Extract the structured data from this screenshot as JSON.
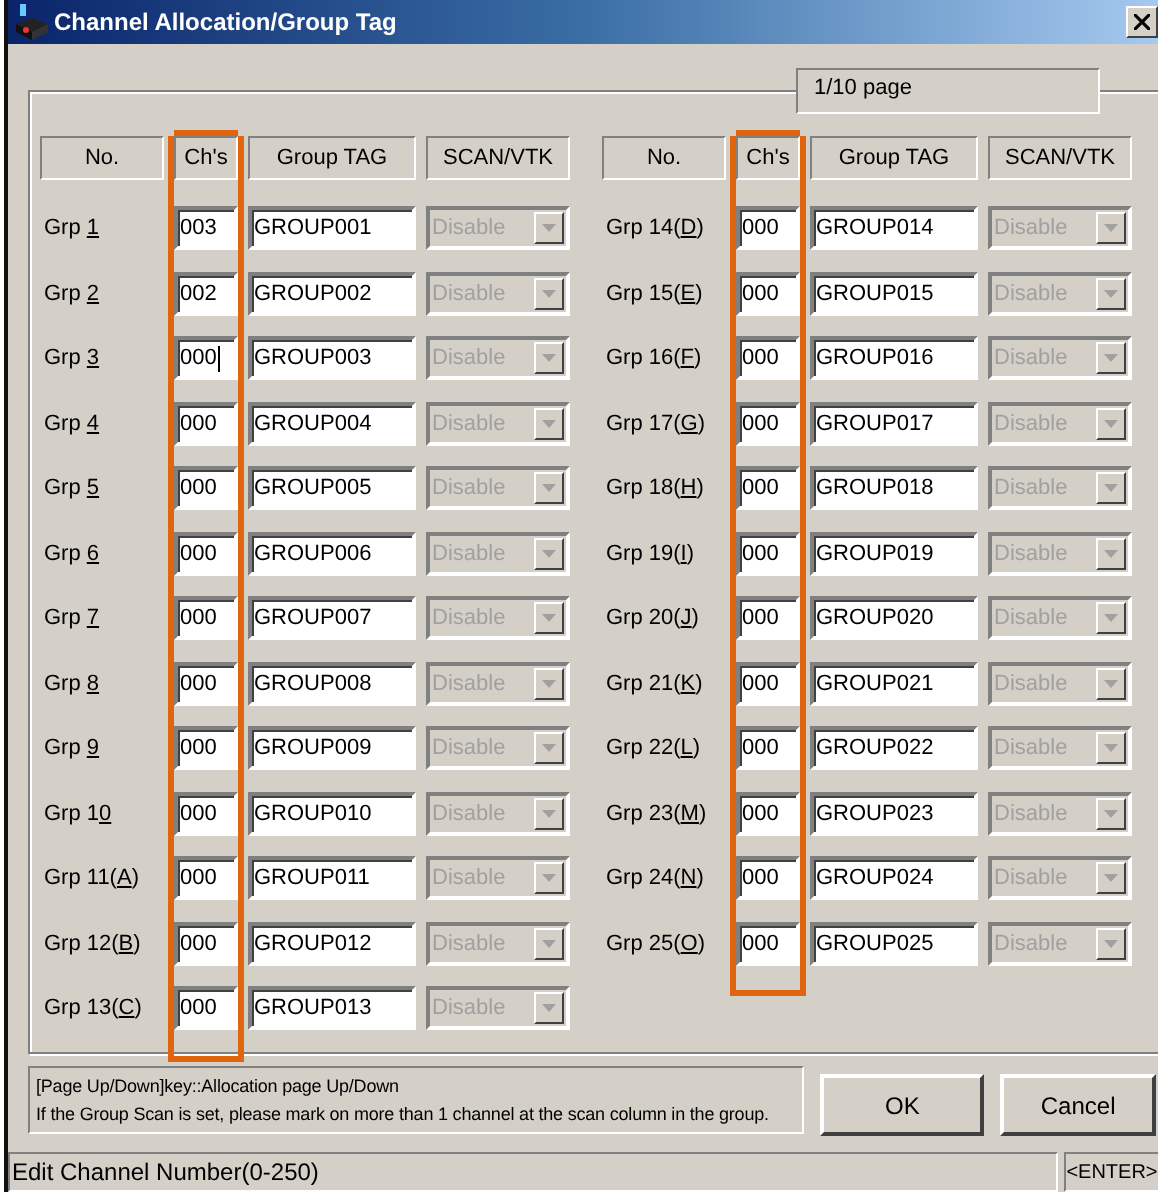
{
  "window": {
    "title": "Channel Allocation/Group Tag"
  },
  "page_indicator": "1/10 page",
  "left_headers": [
    "No.",
    "Ch's",
    "Group TAG",
    "SCAN/VTK"
  ],
  "right_headers": [
    "No.",
    "Ch's",
    "Group TAG",
    "SCAN/VTK"
  ],
  "left_groups": [
    {
      "label": "Grp ",
      "access_key": "1",
      "channels": "003",
      "focused": false,
      "tag": "GROUP001",
      "scan": "Disable",
      "scan_disabled": true
    },
    {
      "label": "Grp ",
      "access_key": "2",
      "channels": "002",
      "focused": false,
      "tag": "GROUP002",
      "scan": "Disable",
      "scan_disabled": true
    },
    {
      "label": "Grp ",
      "access_key": "3",
      "channels": "000",
      "focused": true,
      "tag": "GROUP003",
      "scan": "Disable",
      "scan_disabled": true
    },
    {
      "label": "Grp ",
      "access_key": "4",
      "channels": "000",
      "focused": false,
      "tag": "GROUP004",
      "scan": "Disable",
      "scan_disabled": true
    },
    {
      "label": "Grp ",
      "access_key": "5",
      "channels": "000",
      "focused": false,
      "tag": "GROUP005",
      "scan": "Disable",
      "scan_disabled": true
    },
    {
      "label": "Grp ",
      "access_key": "6",
      "channels": "000",
      "focused": false,
      "tag": "GROUP006",
      "scan": "Disable",
      "scan_disabled": true
    },
    {
      "label": "Grp ",
      "access_key": "7",
      "channels": "000",
      "focused": false,
      "tag": "GROUP007",
      "scan": "Disable",
      "scan_disabled": true
    },
    {
      "label": "Grp ",
      "access_key": "8",
      "channels": "000",
      "focused": false,
      "tag": "GROUP008",
      "scan": "Disable",
      "scan_disabled": true
    },
    {
      "label": "Grp ",
      "access_key": "9",
      "channels": "000",
      "focused": false,
      "tag": "GROUP009",
      "scan": "Disable",
      "scan_disabled": true
    },
    {
      "label": "Grp 1",
      "access_key": "0",
      "channels": "000",
      "focused": false,
      "tag": "GROUP010",
      "scan": "Disable",
      "scan_disabled": true
    },
    {
      "label": "Grp 11(",
      "access_key": "A",
      "label_end": ")",
      "channels": "000",
      "focused": false,
      "tag": "GROUP011",
      "scan": "Disable",
      "scan_disabled": true
    },
    {
      "label": "Grp 12(",
      "access_key": "B",
      "label_end": ")",
      "channels": "000",
      "focused": false,
      "tag": "GROUP012",
      "scan": "Disable",
      "scan_disabled": true
    },
    {
      "label": "Grp 13(",
      "access_key": "C",
      "label_end": ")",
      "channels": "000",
      "focused": false,
      "tag": "GROUP013",
      "scan": "Disable",
      "scan_disabled": true
    }
  ],
  "right_groups": [
    {
      "label": "Grp 14(",
      "access_key": "D",
      "label_end": ")",
      "channels": "000",
      "focused": false,
      "tag": "GROUP014",
      "scan": "Disable",
      "scan_disabled": true
    },
    {
      "label": "Grp 15(",
      "access_key": "E",
      "label_end": ")",
      "channels": "000",
      "focused": false,
      "tag": "GROUP015",
      "scan": "Disable",
      "scan_disabled": true
    },
    {
      "label": "Grp 16(",
      "access_key": "F",
      "label_end": ")",
      "channels": "000",
      "focused": false,
      "tag": "GROUP016",
      "scan": "Disable",
      "scan_disabled": true
    },
    {
      "label": "Grp 17(",
      "access_key": "G",
      "label_end": ")",
      "channels": "000",
      "focused": false,
      "tag": "GROUP017",
      "scan": "Disable",
      "scan_disabled": true
    },
    {
      "label": "Grp 18(",
      "access_key": "H",
      "label_end": ")",
      "channels": "000",
      "focused": false,
      "tag": "GROUP018",
      "scan": "Disable",
      "scan_disabled": true
    },
    {
      "label": "Grp 19(",
      "access_key": "I",
      "label_end": ")",
      "channels": "000",
      "focused": false,
      "tag": "GROUP019",
      "scan": "Disable",
      "scan_disabled": true
    },
    {
      "label": "Grp 20(",
      "access_key": "J",
      "label_end": ")",
      "channels": "000",
      "focused": false,
      "tag": "GROUP020",
      "scan": "Disable",
      "scan_disabled": true
    },
    {
      "label": "Grp 21(",
      "access_key": "K",
      "label_end": ")",
      "channels": "000",
      "focused": false,
      "tag": "GROUP021",
      "scan": "Disable",
      "scan_disabled": true
    },
    {
      "label": "Grp 22(",
      "access_key": "L",
      "label_end": ")",
      "channels": "000",
      "focused": false,
      "tag": "GROUP022",
      "scan": "Disable",
      "scan_disabled": true
    },
    {
      "label": "Grp 23(",
      "access_key": "M",
      "label_end": ")",
      "channels": "000",
      "focused": false,
      "tag": "GROUP023",
      "scan": "Disable",
      "scan_disabled": true
    },
    {
      "label": "Grp 24(",
      "access_key": "N",
      "label_end": ")",
      "channels": "000",
      "focused": false,
      "tag": "GROUP024",
      "scan": "Disable",
      "scan_disabled": true
    },
    {
      "label": "Grp 25(",
      "access_key": "O",
      "label_end": ")",
      "channels": "000",
      "focused": false,
      "tag": "GROUP025",
      "scan": "Disable",
      "scan_disabled": true
    }
  ],
  "hint_lines": [
    "[Page Up/Down]key::Allocation page Up/Down",
    "If the Group Scan is set, please mark on more than 1 channel at the scan column in the group."
  ],
  "buttons": [
    "OK",
    "Cancel"
  ],
  "status_bar": {
    "text": "Edit Channel Number(0-250)",
    "key": "<ENTER>"
  }
}
